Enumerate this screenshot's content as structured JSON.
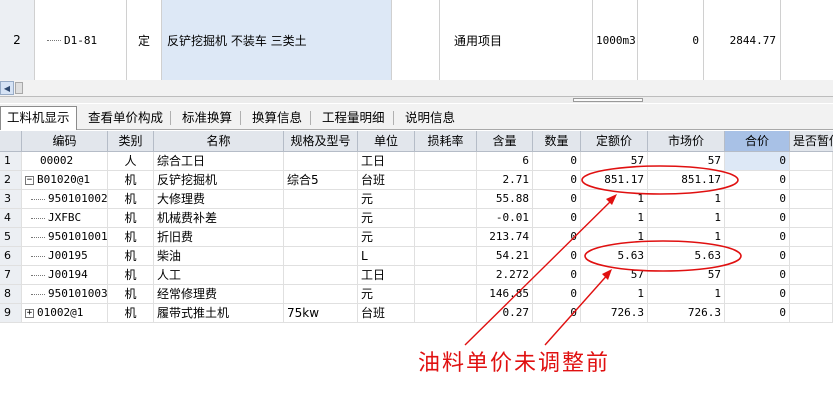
{
  "top_row": {
    "row_number": "2",
    "code": "D1-81",
    "type": "定",
    "name": "反铲挖掘机 不装车 三类土",
    "category": "通用项目",
    "unit": "1000m3",
    "quantity": "0",
    "price": "2844.77"
  },
  "tabs": [
    {
      "label": "工料机显示",
      "active": true
    },
    {
      "label": "查看单价构成"
    },
    {
      "label": "标准换算"
    },
    {
      "label": "换算信息"
    },
    {
      "label": "工程量明细"
    },
    {
      "label": "说明信息"
    }
  ],
  "columns": [
    "编码",
    "类别",
    "名称",
    "规格及型号",
    "单位",
    "损耗率",
    "含量",
    "数量",
    "定额价",
    "市场价",
    "合价",
    "是否暂估"
  ],
  "rows": [
    {
      "num": "1",
      "code": "00002",
      "type": "人",
      "name": "综合工日",
      "spec": "",
      "unit": "工日",
      "loss": "",
      "content": "6",
      "qty": "0",
      "quota": "57",
      "market": "57",
      "total": "0",
      "tree": "none"
    },
    {
      "num": "2",
      "code": "B01020@1",
      "type": "机",
      "name": "反铲挖掘机",
      "spec": "综合5",
      "unit": "台班",
      "loss": "",
      "content": "2.71",
      "qty": "0",
      "quota": "851.17",
      "market": "851.17",
      "total": "0",
      "tree": "minus"
    },
    {
      "num": "3",
      "code": "950101002",
      "type": "机",
      "name": "大修理费",
      "spec": "",
      "unit": "元",
      "loss": "",
      "content": "55.88",
      "qty": "0",
      "quota": "1",
      "market": "1",
      "total": "0",
      "tree": "child"
    },
    {
      "num": "4",
      "code": "JXFBC",
      "type": "机",
      "name": "机械费补差",
      "spec": "",
      "unit": "元",
      "loss": "",
      "content": "-0.01",
      "qty": "0",
      "quota": "1",
      "market": "1",
      "total": "0",
      "tree": "child"
    },
    {
      "num": "5",
      "code": "950101001",
      "type": "机",
      "name": "折旧费",
      "spec": "",
      "unit": "元",
      "loss": "",
      "content": "213.74",
      "qty": "0",
      "quota": "1",
      "market": "1",
      "total": "0",
      "tree": "child"
    },
    {
      "num": "6",
      "code": "J00195",
      "type": "机",
      "name": "柴油",
      "spec": "",
      "unit": "L",
      "loss": "",
      "content": "54.21",
      "qty": "0",
      "quota": "5.63",
      "market": "5.63",
      "total": "0",
      "tree": "child"
    },
    {
      "num": "7",
      "code": "J00194",
      "type": "机",
      "name": "人工",
      "spec": "",
      "unit": "工日",
      "loss": "",
      "content": "2.272",
      "qty": "0",
      "quota": "57",
      "market": "57",
      "total": "0",
      "tree": "child"
    },
    {
      "num": "8",
      "code": "950101003",
      "type": "机",
      "name": "经常修理费",
      "spec": "",
      "unit": "元",
      "loss": "",
      "content": "146.85",
      "qty": "0",
      "quota": "1",
      "market": "1",
      "total": "0",
      "tree": "child"
    },
    {
      "num": "9",
      "code": "01002@1",
      "type": "机",
      "name": "履带式推土机",
      "spec": "75kw",
      "unit": "台班",
      "loss": "",
      "content": "0.27",
      "qty": "0",
      "quota": "726.3",
      "market": "726.3",
      "total": "0",
      "tree": "plus"
    }
  ],
  "annotation": {
    "text": "油料单价未调整前",
    "color": "#e01010"
  }
}
